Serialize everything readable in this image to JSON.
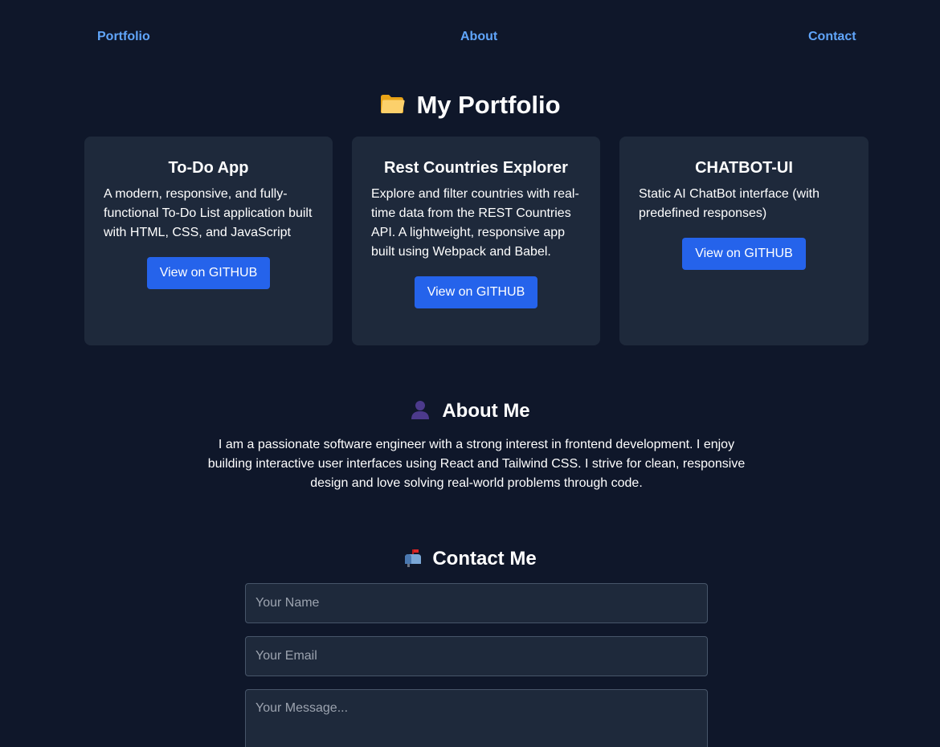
{
  "nav": {
    "portfolio": "Portfolio",
    "about": "About",
    "contact": "Contact"
  },
  "portfolio": {
    "title": "My Portfolio",
    "icon": "folder-icon",
    "projects": [
      {
        "title": "To-Do App",
        "description": "A modern, responsive, and fully-functional To-Do List application built with HTML, CSS, and JavaScript",
        "button": "View on GITHUB"
      },
      {
        "title": "Rest Countries Explorer",
        "description": "Explore and filter countries with real-time data from the REST Countries API. A lightweight, responsive app built using Webpack and Babel.",
        "button": "View on GITHUB"
      },
      {
        "title": "CHATBOT-UI",
        "description": "Static AI ChatBot interface (with predefined responses)",
        "button": "View on GITHUB"
      }
    ]
  },
  "about": {
    "title": "About Me",
    "icon": "person-silhouette-icon",
    "text": "I am a passionate software engineer with a strong interest in frontend development. I enjoy building interactive user interfaces using React and Tailwind CSS. I strive for clean, responsive design and love solving real-world problems through code."
  },
  "contact": {
    "title": "Contact Me",
    "icon": "mailbox-icon",
    "name_placeholder": "Your Name",
    "email_placeholder": "Your Email",
    "message_placeholder": "Your Message..."
  },
  "colors": {
    "background": "#0f172a",
    "card": "#1e293b",
    "accent": "#2563eb",
    "link": "#60a5fa"
  }
}
